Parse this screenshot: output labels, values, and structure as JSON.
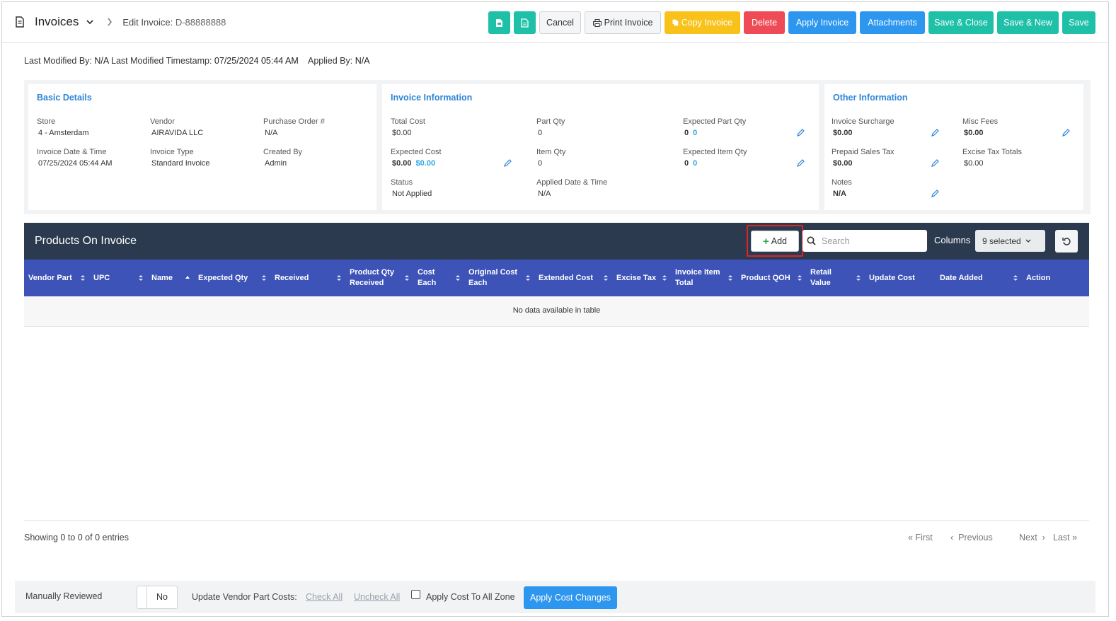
{
  "header": {
    "title": "Invoices",
    "breadcrumb_label": "Edit Invoice:",
    "invoice_id": "D-88888888",
    "buttons": {
      "cancel": "Cancel",
      "print": "Print Invoice",
      "copy": "Copy Invoice",
      "delete": "Delete",
      "apply": "Apply Invoice",
      "attachments": "Attachments",
      "save_close": "Save & Close",
      "save_new": "Save & New",
      "save": "Save"
    }
  },
  "meta": {
    "last_modified_by_label": "Last Modified By:",
    "last_modified_by": "N/A",
    "last_modified_ts_label": "Last Modified Timestamp:",
    "last_modified_ts": "07/25/2024 05:44 AM",
    "applied_by_label": "Applied By:",
    "applied_by": "N/A"
  },
  "basic_details": {
    "heading": "Basic Details",
    "store_label": "Store",
    "store": "4 - Amsterdam",
    "vendor_label": "Vendor",
    "vendor": "AIRAVIDA LLC",
    "po_label": "Purchase Order #",
    "po": "N/A",
    "date_label": "Invoice Date & Time",
    "date": "07/25/2024 05:44 AM",
    "type_label": "Invoice Type",
    "type": "Standard Invoice",
    "created_label": "Created By",
    "created": "Admin"
  },
  "invoice_info": {
    "heading": "Invoice Information",
    "total_cost_label": "Total Cost",
    "total_cost": "$0.00",
    "part_qty_label": "Part Qty",
    "part_qty": "0",
    "exp_part_qty_label": "Expected Part Qty",
    "exp_part_qty": "0",
    "exp_part_qty_alt": "0",
    "exp_cost_label": "Expected Cost",
    "exp_cost": "$0.00",
    "exp_cost_alt": "$0.00",
    "item_qty_label": "Item Qty",
    "item_qty": "0",
    "exp_item_qty_label": "Expected Item Qty",
    "exp_item_qty": "0",
    "exp_item_qty_alt": "0",
    "status_label": "Status",
    "status": "Not Applied",
    "applied_dt_label": "Applied Date & Time",
    "applied_dt": "N/A"
  },
  "other_info": {
    "heading": "Other Information",
    "surcharge_label": "Invoice Surcharge",
    "surcharge": "$0.00",
    "misc_label": "Misc Fees",
    "misc": "$0.00",
    "prepaid_label": "Prepaid Sales Tax",
    "prepaid": "$0.00",
    "excise_label": "Excise Tax Totals",
    "excise": "$0.00",
    "notes_label": "Notes",
    "notes": "N/A"
  },
  "products": {
    "title": "Products On Invoice",
    "add_label": "Add",
    "search_placeholder": "Search",
    "columns_label": "Columns",
    "columns_selected": "9 selected",
    "headers": [
      "Vendor Part",
      "UPC",
      "Name",
      "Expected Qty",
      "Received",
      "Product Qty Received",
      "Cost Each",
      "Original Cost Each",
      "Extended Cost",
      "Excise Tax",
      "Invoice Item Total",
      "Product QOH",
      "Retail Value",
      "Update Cost",
      "Date Added",
      "Action"
    ],
    "empty_text": "No data available in table",
    "showing": "Showing 0 to 0 of 0 entries",
    "pager": {
      "first": "First",
      "previous": "Previous",
      "next": "Next",
      "last": "Last"
    }
  },
  "footer": {
    "manually_reviewed_label": "Manually Reviewed",
    "manually_reviewed_value": "No",
    "update_vendor_label": "Update Vendor Part Costs:",
    "check_all": "Check All",
    "uncheck_all": "Uncheck All",
    "apply_zone_label": "Apply Cost To All Zone",
    "apply_cost_changes": "Apply Cost Changes"
  },
  "colors": {
    "teal": "#1fc0a8",
    "yellow": "#f8c21a",
    "red": "#ee4b57",
    "blue": "#2d96ef",
    "table_header": "#3d53b8",
    "panel_header": "#2b3a4f",
    "heading_blue": "#2e86d8"
  },
  "icons": [
    "document-icon",
    "chevron-down-icon",
    "chevron-right-icon",
    "file-icon",
    "printer-icon",
    "copy-icon",
    "pencil-icon",
    "plus-icon",
    "search-icon",
    "reset-icon",
    "sort-icon"
  ]
}
